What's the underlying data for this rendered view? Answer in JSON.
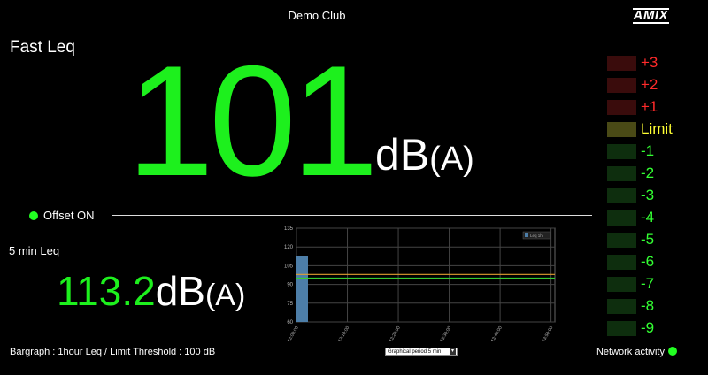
{
  "header": {
    "venue": "Demo Club",
    "logo": "AMIX"
  },
  "fast": {
    "title": "Fast Leq",
    "value": "101",
    "unit": "dB",
    "unit_weight": "(A)"
  },
  "offset": {
    "label": "Offset ON",
    "color": "#22ff22"
  },
  "short": {
    "title": "5 min Leq",
    "value": "113.2",
    "unit": "dB",
    "unit_weight": "(A)"
  },
  "footer": {
    "left": "Bargraph : 1hour Leq / Limit Threshold : 100 dB",
    "period_select": "Graphical period 5 min",
    "network": "Network activity",
    "network_color": "#22ff22"
  },
  "ladder": [
    {
      "label": "+3",
      "text_color": "#ff2a2a",
      "box_color": "#3a0c0c"
    },
    {
      "label": "+2",
      "text_color": "#ff2a2a",
      "box_color": "#3a0c0c"
    },
    {
      "label": "+1",
      "text_color": "#ff2a2a",
      "box_color": "#3a0c0c"
    },
    {
      "label": "Limit",
      "text_color": "#ffff33",
      "box_color": "#4a4a16"
    },
    {
      "label": "-1",
      "text_color": "#33ff33",
      "box_color": "#0e2e0e"
    },
    {
      "label": "-2",
      "text_color": "#33ff33",
      "box_color": "#0e2e0e"
    },
    {
      "label": "-3",
      "text_color": "#33ff33",
      "box_color": "#0e2e0e"
    },
    {
      "label": "-4",
      "text_color": "#33ff33",
      "box_color": "#0e2e0e"
    },
    {
      "label": "-5",
      "text_color": "#33ff33",
      "box_color": "#0e2e0e"
    },
    {
      "label": "-6",
      "text_color": "#33ff33",
      "box_color": "#0e2e0e"
    },
    {
      "label": "-7",
      "text_color": "#33ff33",
      "box_color": "#0e2e0e"
    },
    {
      "label": "-8",
      "text_color": "#33ff33",
      "box_color": "#0e2e0e"
    },
    {
      "label": "-9",
      "text_color": "#33ff33",
      "box_color": "#0e2e0e"
    }
  ],
  "chart_data": {
    "type": "bar",
    "x_ticks": [
      "13:00:00",
      "13:10:00",
      "13:20:00",
      "13:30:00",
      "13:40:00",
      "13:50:00"
    ],
    "y_ticks": [
      60,
      75,
      90,
      105,
      120,
      135
    ],
    "ylim": [
      60,
      135
    ],
    "grid": true,
    "legend": "top-right",
    "series": [
      {
        "name": "Leq 1h",
        "type": "bar",
        "color": "#4d7ea8",
        "values": [
          113
        ]
      }
    ],
    "lines": [
      {
        "value": 98,
        "color": "#e0a030"
      },
      {
        "value": 95,
        "color": "#33cc33"
      }
    ]
  }
}
